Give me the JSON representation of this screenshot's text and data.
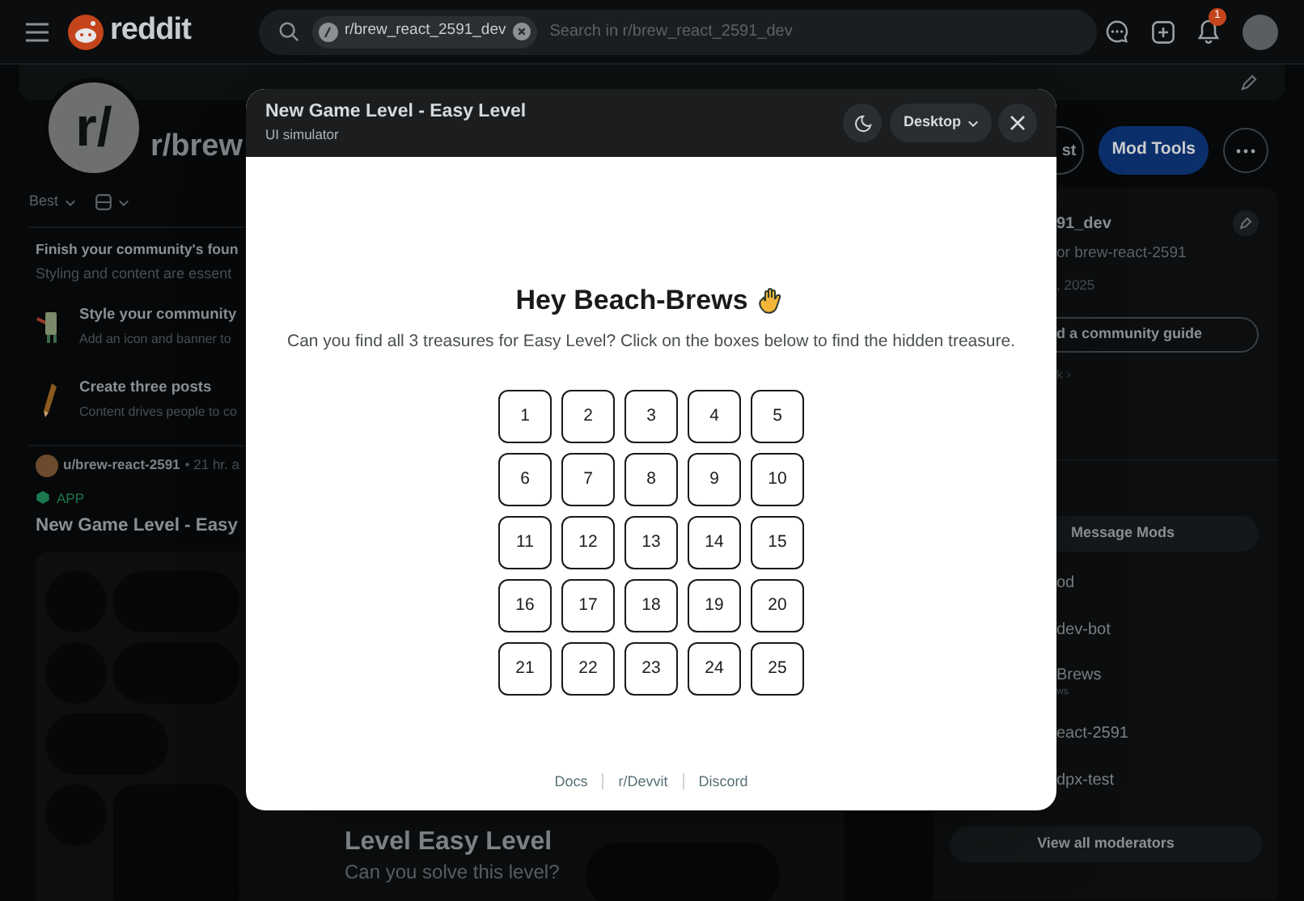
{
  "header": {
    "logo_text": "reddit",
    "search_chip": "r/brew_react_2591_dev",
    "search_placeholder": "Search in r/brew_react_2591_dev",
    "notification_count": "1"
  },
  "community": {
    "avatar_text": "r/",
    "name": "r/brew",
    "buttons": [
      {
        "label": "st",
        "kind": "outline"
      },
      {
        "label": "Mod Tools",
        "kind": "primary"
      },
      {
        "kind": "more"
      }
    ]
  },
  "feed": {
    "sort": "Best",
    "setup_card": {
      "title": "Finish your community's foun",
      "subtitle": "Styling and content are essent",
      "tasks": [
        {
          "kind": "style",
          "title": "Style your community",
          "subtitle": "Add an icon and banner to"
        },
        {
          "kind": "posts",
          "title": "Create three posts",
          "subtitle": "Content drives people to co"
        }
      ]
    },
    "post": {
      "author": "u/brew-react-2591",
      "time": "• 21 hr. a",
      "tag": "APP",
      "title": "New Game Level - Easy",
      "preview_title": "Level Easy Level",
      "preview_subtitle": "Can you solve this level?"
    }
  },
  "sidebar": {
    "name": "91_dev",
    "description": "or brew-react-2591",
    "date": ", 2025",
    "guide_button": "d a community guide",
    "link": "k ›",
    "message_button": "Message Mods",
    "moderators": [
      {
        "name": "od"
      },
      {
        "name": "dev-bot"
      },
      {
        "name": "Brews",
        "flair": "ws"
      },
      {
        "name": "eact-2591"
      },
      {
        "name": "dpx-test"
      }
    ],
    "view_all": "View all moderators"
  },
  "modal": {
    "title": "New Game Level - Easy Level",
    "subtitle": "UI simulator",
    "device": "Desktop",
    "heading": "Hey Beach-Brews",
    "text": "Can you find all 3 treasures for Easy Level? Click on the boxes below to find the hidden treasure.",
    "cells": [
      "1",
      "2",
      "3",
      "4",
      "5",
      "6",
      "7",
      "8",
      "9",
      "10",
      "11",
      "12",
      "13",
      "14",
      "15",
      "16",
      "17",
      "18",
      "19",
      "20",
      "21",
      "22",
      "23",
      "24",
      "25"
    ],
    "footer_links": [
      "Docs",
      "r/Devvit",
      "Discord"
    ]
  }
}
